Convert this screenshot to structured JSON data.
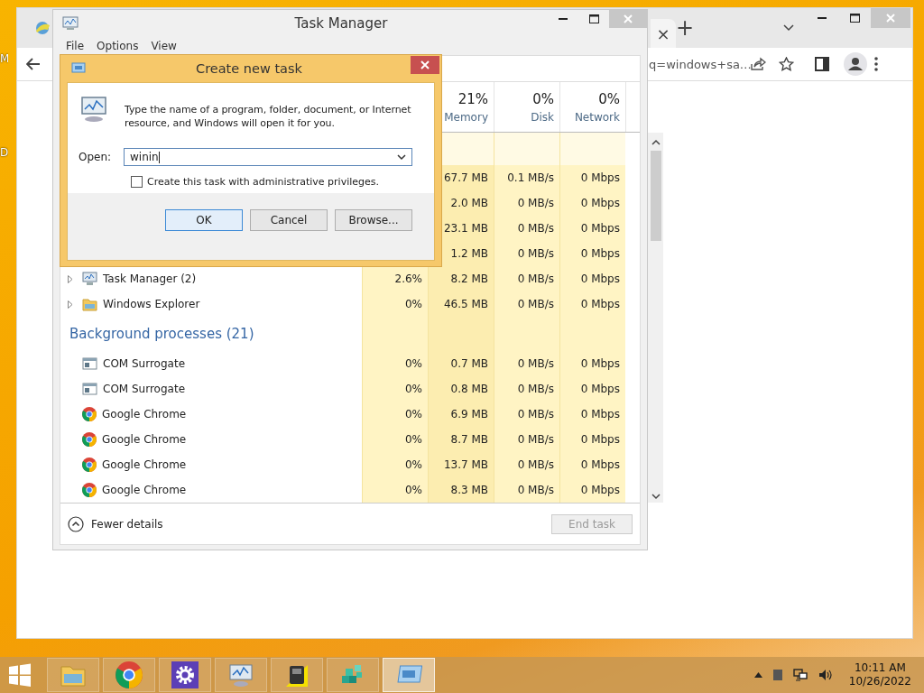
{
  "desktop": {
    "icon_labels": [
      "M",
      "D"
    ]
  },
  "browser": {
    "tab_close": "×",
    "new_tab": "+",
    "address": "q=windows+sa…"
  },
  "task_manager": {
    "title": "Task Manager",
    "menu": [
      "File",
      "Options",
      "View"
    ],
    "columns": [
      {
        "percent": "21%",
        "label": "Memory"
      },
      {
        "percent": "0%",
        "label": "Disk"
      },
      {
        "percent": "0%",
        "label": "Network"
      }
    ],
    "rows": [
      {
        "kind": "group"
      },
      {
        "kind": "app",
        "memory": "67.7 MB",
        "disk": "0.1 MB/s",
        "network": "0 Mbps"
      },
      {
        "kind": "app",
        "memory": "2.0 MB",
        "disk": "0 MB/s",
        "network": "0 Mbps"
      },
      {
        "kind": "app",
        "memory": "23.1 MB",
        "disk": "0 MB/s",
        "network": "0 Mbps"
      },
      {
        "kind": "app",
        "memory": "1.2 MB",
        "disk": "0 MB/s",
        "network": "0 Mbps"
      },
      {
        "kind": "monitor",
        "name": "Task Manager (2)",
        "expandable": true,
        "cpu": "2.6%",
        "memory": "8.2 MB",
        "disk": "0 MB/s",
        "network": "0 Mbps"
      },
      {
        "kind": "folder",
        "name": "Windows Explorer",
        "expandable": true,
        "cpu": "0%",
        "memory": "46.5 MB",
        "disk": "0 MB/s",
        "network": "0 Mbps"
      },
      {
        "kind": "group",
        "label": "Background processes (21)"
      },
      {
        "kind": "service",
        "name": "COM Surrogate",
        "expandable": false,
        "cpu": "0%",
        "memory": "0.7 MB",
        "disk": "0 MB/s",
        "network": "0 Mbps"
      },
      {
        "kind": "service",
        "name": "COM Surrogate",
        "expandable": false,
        "cpu": "0%",
        "memory": "0.8 MB",
        "disk": "0 MB/s",
        "network": "0 Mbps"
      },
      {
        "kind": "chrome",
        "name": "Google Chrome",
        "expandable": false,
        "cpu": "0%",
        "memory": "6.9 MB",
        "disk": "0 MB/s",
        "network": "0 Mbps"
      },
      {
        "kind": "chrome",
        "name": "Google Chrome",
        "expandable": false,
        "cpu": "0%",
        "memory": "8.7 MB",
        "disk": "0 MB/s",
        "network": "0 Mbps"
      },
      {
        "kind": "chrome",
        "name": "Google Chrome",
        "expandable": false,
        "cpu": "0%",
        "memory": "13.7 MB",
        "disk": "0 MB/s",
        "network": "0 Mbps"
      },
      {
        "kind": "chrome",
        "name": "Google Chrome",
        "expandable": false,
        "cpu": "0%",
        "memory": "8.3 MB",
        "disk": "0 MB/s",
        "network": "0 Mbps"
      }
    ],
    "fewer_details": "Fewer details",
    "end_task": {
      "label": "End task",
      "disabled": true
    }
  },
  "dialog": {
    "title": "Create new task",
    "message": "Type the name of a program, folder, document, or Internet resource, and Windows will open it for you.",
    "open_label": "Open:",
    "open_value": "winin",
    "admin_checkbox": {
      "label": "Create this task with administrative privileges.",
      "checked": false
    },
    "buttons": [
      {
        "label": "OK",
        "selected": true
      },
      {
        "label": "Cancel",
        "selected": false
      },
      {
        "label": "Browse...",
        "selected": false
      }
    ]
  },
  "taskbar": {
    "apps": [
      {
        "kind": "folder",
        "selected": false
      },
      {
        "kind": "chrome",
        "selected": false
      },
      {
        "kind": "gear",
        "selected": false
      },
      {
        "kind": "monitor",
        "selected": false
      },
      {
        "kind": "drive",
        "selected": false
      },
      {
        "kind": "cubes",
        "selected": false
      },
      {
        "kind": "window",
        "selected": true
      }
    ],
    "time": "10:11 AM",
    "date": "10/26/2022"
  }
}
